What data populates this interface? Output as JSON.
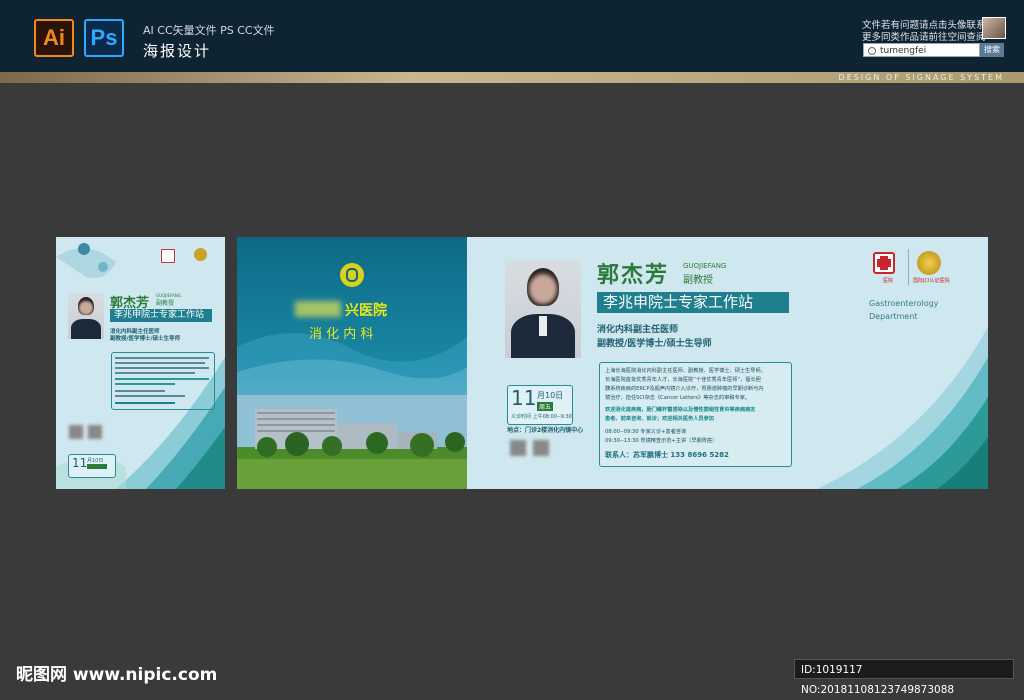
{
  "header": {
    "ai_icon": "Ai",
    "ps_icon": "Ps",
    "files_label": "AI CC矢量文件   PS CC文件",
    "title": "海报设计",
    "note_line1": "文件若有问题请点击头像联系",
    "note_line2": "更多同类作品请前往空间查阅",
    "search_value": "tumengfei",
    "search_button": "搜索",
    "tagline": "DESIGN OF SIGNAGE SYSTEM"
  },
  "small_poster": {
    "name": "郭杰芳",
    "name_pinyin": "GUOJIEFANG",
    "rank": "副教授",
    "station": "李兆申院士专家工作站",
    "role1": "消化内科副主任医师",
    "role2": "副教授/医学博士/硕士生导师",
    "month_day": "11",
    "date": "月10日"
  },
  "left_panel": {
    "hospital": "兴医院",
    "department": "消 化 内 科"
  },
  "right_panel": {
    "name": "郭杰芳",
    "name_pinyin": "GUOJIEFANG",
    "rank": "副教授",
    "station": "李兆申院士专家工作站",
    "role1": "消化内科副主任医师",
    "role2": "副教授/医学博士/硕士生导师",
    "dept_en1": "Gastroenterology",
    "dept_en2": "Department",
    "logo_label1": "医院",
    "logo_label2": "国际JCI认证医院",
    "bio1": "上海长海医院消化内科副主任医师、副教授、医学博士、硕士生导师。",
    "bio2": "长海医院首批优秀青年人才，长海医院“十佳优秀青年医师”，擅长胆",
    "bio3": "胰系统疾病的ERCP及超声内镜介入诊疗，胃肠道肿瘤的早期诊断与内",
    "bio4": "镜治疗，担任SCI杂志《Cancer Letters》等杂志的审稿专家。",
    "invite1": "欢迎消化道疾病，肠门螺杆菌感染以及慢性萎缩性胃炎等疾病病友",
    "invite2": "患者、前来咨询、就诊；欢迎相关医务人员参加",
    "schedule1": "08:00--09:30  专家义诊+患者咨询",
    "schedule2": "09:30--13:30  胃镜精查示范+主讲（早期胃癌）",
    "contact": "联系人：苏军鹏博士  133 8696 5282",
    "month_day": "11",
    "date": "月10日",
    "weekday": "周五",
    "time": "义诊时间  上午08:00--9:30",
    "place": "地点：门诊2楼消化内镜中心"
  },
  "footer": {
    "site": "昵图网 www.nipic.com",
    "id_text": "ID:1019117 NO:20181108123749873088"
  },
  "colors": {
    "teal": "#1f7f8f",
    "green": "#2c7a3a",
    "header_bg": "#0f2433",
    "gold": "#c8b690"
  }
}
